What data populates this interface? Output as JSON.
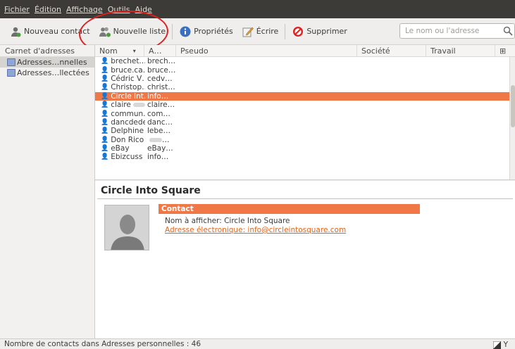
{
  "menu": [
    "Fichier",
    "Édition",
    "Affichage",
    "Outils",
    "Aide"
  ],
  "toolbar": {
    "new_contact": "Nouveau contact",
    "new_list": "Nouvelle liste",
    "properties": "Propriétés",
    "write": "Écrire",
    "delete": "Supprimer"
  },
  "search": {
    "placeholder": "Le nom ou l'adresse"
  },
  "sidebar": {
    "header": "Carnet d'adresses",
    "items": [
      "Adresses…nnelles",
      "Adresses…llectées"
    ]
  },
  "list": {
    "columns": [
      "Nom",
      "A…",
      "Pseudo",
      "Société",
      "Travail"
    ],
    "rows": [
      {
        "name": "brechet.…",
        "mail": "brech…",
        "blur": false
      },
      {
        "name": "bruce.ca…",
        "mail": "bruce…",
        "blur": false
      },
      {
        "name": "Cédric V…",
        "mail": "cedv…",
        "blur": false
      },
      {
        "name": "Christop…",
        "mail": "christ…",
        "blur": false
      },
      {
        "name": "Circle Int…",
        "mail": "info…",
        "blur": false,
        "selected": true
      },
      {
        "name": "claire",
        "mail": "claire…",
        "blur": true
      },
      {
        "name": "commun…",
        "mail": "com…",
        "blur": false
      },
      {
        "name": "dancdede",
        "mail": "danc…",
        "blur": false
      },
      {
        "name": "Delphine L",
        "mail": "lebe…",
        "blur": false
      },
      {
        "name": "Don Rico",
        "mail": "…",
        "blur": true
      },
      {
        "name": "eBay",
        "mail": "eBay…",
        "blur": false
      },
      {
        "name": "Ebizcuss",
        "mail": "info…",
        "blur": false
      }
    ]
  },
  "detail": {
    "title": "Circle Into Square",
    "section": "Contact",
    "display_name": "Nom à afficher: Circle Into Square",
    "email": "Adresse électronique: info@circleintosquare.com"
  },
  "status": {
    "text": "Nombre de contacts dans Adresses personnelles : 46",
    "right_label": "Y"
  },
  "colors": {
    "accent": "#f07746",
    "menubar": "#3c3b37",
    "annotation": "#e02020"
  }
}
